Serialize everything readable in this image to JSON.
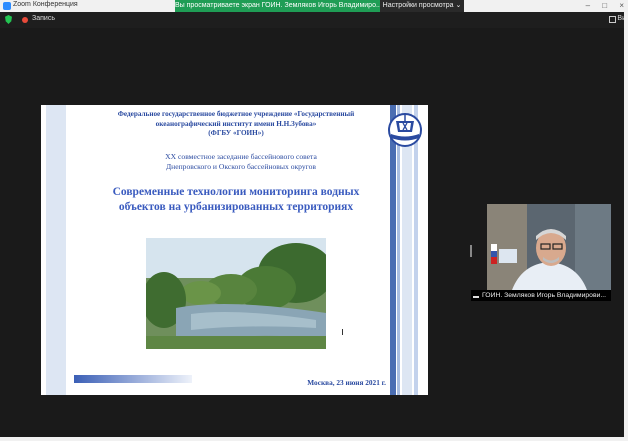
{
  "window": {
    "title": "Zoom Конференция",
    "share_banner": "Вы просматриваете экран ГОИН. Земляков Игорь Владимиро...",
    "view_options": "Настройки просмотра ⌄",
    "controls": [
      "–",
      "□",
      "×"
    ]
  },
  "toolbar": {
    "record_label": "Запись",
    "view_label": "Ви"
  },
  "slide": {
    "org_line1": "Федеральное государственное бюджетное учреждение «Государственный",
    "org_line2": "океанографический институт имени Н.Н.Зубова»",
    "org_line3": "(ФГБУ «ГОИН»)",
    "meeting_line1": "XX совместное заседание бассейнового совета",
    "meeting_line2": "Днепровского и Окского бассейновых округов",
    "title_line1": "Современные технологии мониторинга водных",
    "title_line2": "объектов на урбанизированных территориях",
    "date": "Москва, 23 июня 2021 г."
  },
  "participant": {
    "name": "ГОИН. Земляков Игорь Владимирови..."
  },
  "icons": {
    "security": "shield-icon",
    "recording": "record-dot-icon",
    "view": "grid-icon",
    "audio": "signal-bars-icon"
  },
  "colors": {
    "slide_text": "#2a4aa0",
    "banner": "#1f9d55",
    "accent_stripe": "#4a6db2",
    "recording": "#e84a3a"
  }
}
